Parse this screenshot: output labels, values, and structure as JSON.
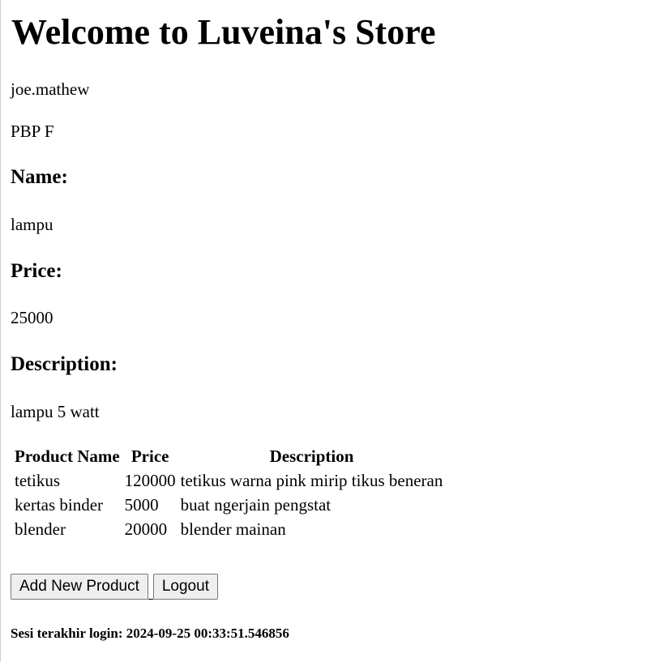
{
  "header": {
    "title": "Welcome to Luveina's Store"
  },
  "user": {
    "username": "joe.mathew",
    "class": "PBP F"
  },
  "product": {
    "name_label": "Name:",
    "name_value": "lampu",
    "price_label": "Price:",
    "price_value": "25000",
    "description_label": "Description:",
    "description_value": "lampu 5 watt"
  },
  "table": {
    "headers": [
      "Product Name",
      "Price",
      "Description"
    ],
    "rows": [
      [
        "tetikus",
        "120000",
        "tetikus warna pink mirip tikus beneran"
      ],
      [
        "kertas binder",
        "5000",
        "buat ngerjain pengstat"
      ],
      [
        "blender",
        "20000",
        "blender mainan"
      ]
    ]
  },
  "actions": {
    "add_label": "Add New Product",
    "logout_label": "Logout"
  },
  "session": {
    "last_login": "Sesi terakhir login: 2024-09-25 00:33:51.546856"
  }
}
